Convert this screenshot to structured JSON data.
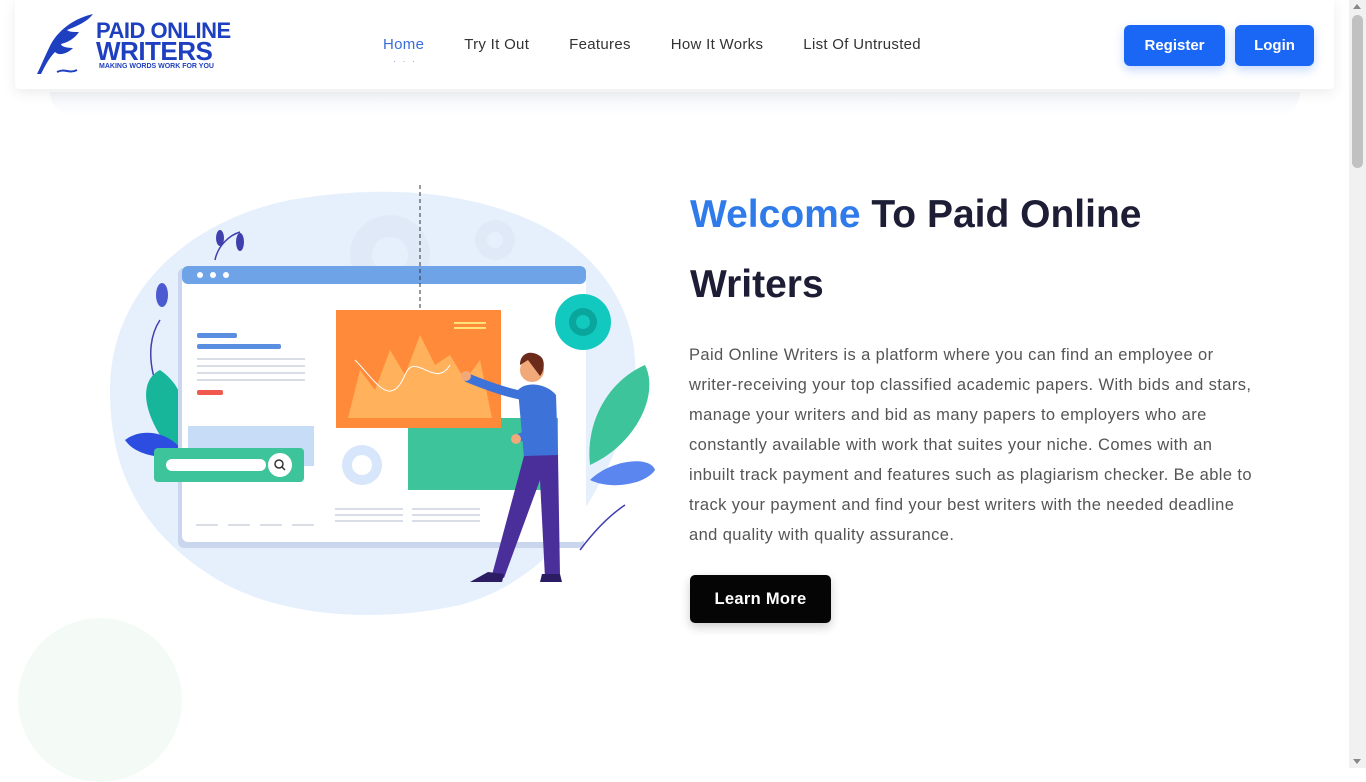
{
  "brand": {
    "line1": "PAID ONLINE",
    "line2": "WRITERS",
    "tagline": "MAKING WORDS WORK FOR YOU",
    "color": "#1e3fbf"
  },
  "nav": {
    "items": [
      {
        "label": "Home",
        "active": true
      },
      {
        "label": "Try It Out",
        "active": false
      },
      {
        "label": "Features",
        "active": false
      },
      {
        "label": "How It Works",
        "active": false
      },
      {
        "label": "List Of Untrusted",
        "active": false
      }
    ]
  },
  "auth": {
    "register_label": "Register",
    "login_label": "Login",
    "button_color": "#1a66f5"
  },
  "hero": {
    "title_accent": "Welcome",
    "title_rest": " To Paid Online Writers",
    "accent_color": "#2f7be9",
    "body": "Paid Online Writers is a platform where you can find an employee or writer-receiving your top classified academic papers. With bids and stars, manage your writers and bid as many papers to employers who are constantly available with work that suites your niche. Comes with an inbuilt track payment and features such as plagiarism checker. Be able to track your payment and find your best writers with the needed deadline and quality with quality assurance.",
    "cta_label": "Learn More"
  },
  "illustration": {
    "icons": [
      "quill-logo-icon",
      "browser-window-icon",
      "search-icon",
      "chart-card-icon",
      "gear-icon",
      "person-figure",
      "leaf-icon"
    ]
  }
}
